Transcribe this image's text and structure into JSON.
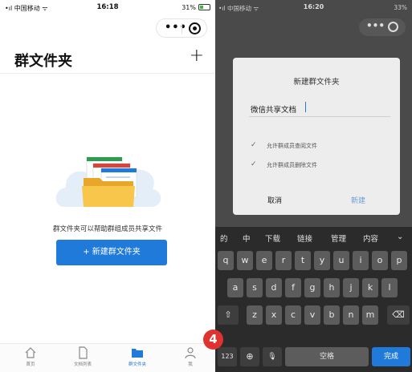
{
  "left_phone": {
    "status": {
      "carrier": "•ıl 中国移动 ᯤ",
      "time": "16:18",
      "battery": "31%"
    },
    "capsule": {
      "more": "•••"
    },
    "title": "群文件夹",
    "plus": "+",
    "empty_text": "群文件夹可以帮助群组成员共享文件",
    "new_button": "+ 新建群文件夹",
    "tabs": [
      {
        "label": "首页",
        "icon": "home-icon"
      },
      {
        "label": "文档列表",
        "icon": "document-icon"
      },
      {
        "label": "群文件夹",
        "icon": "folder-icon",
        "active": true
      },
      {
        "label": "我",
        "icon": "person-icon"
      }
    ]
  },
  "right_phone": {
    "status": {
      "carrier": "•ıl 中国移动 ᯤ",
      "time": "16:20",
      "battery": "33%"
    },
    "capsule": {
      "more": "•••"
    },
    "dialog": {
      "title": "新建群文件夹",
      "input_value": "微信共享文档",
      "options": [
        {
          "label": "允许群成员查阅文件",
          "checked": true
        },
        {
          "label": "允许群成员删除文件",
          "checked": true
        }
      ],
      "cancel": "取消",
      "confirm": "新建"
    },
    "keyboard": {
      "candidates": [
        "的",
        "中",
        "下载",
        "链接",
        "管理",
        "内容"
      ],
      "chevron": "⌄",
      "row1": [
        "q",
        "w",
        "e",
        "r",
        "t",
        "y",
        "u",
        "i",
        "o",
        "p"
      ],
      "row2": [
        "a",
        "s",
        "d",
        "f",
        "g",
        "h",
        "j",
        "k",
        "l"
      ],
      "row3": [
        "z",
        "x",
        "c",
        "v",
        "b",
        "n",
        "m"
      ],
      "shift": "⇧",
      "backspace": "⌫",
      "num": "123",
      "globe": "⊕",
      "mic": "🎙",
      "space": "空格",
      "enter": "完成"
    }
  },
  "badge": "4",
  "colors": {
    "accent": "#1f7ad9",
    "badge": "#e0332f"
  }
}
